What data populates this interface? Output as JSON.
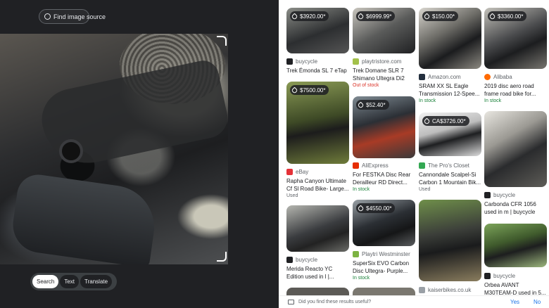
{
  "left": {
    "find_source": "Find image source",
    "modes": [
      "Search",
      "Text",
      "Translate"
    ],
    "active_mode": "Search"
  },
  "results": [
    [
      {
        "price": "$3920.00*",
        "source": "buycycle",
        "title": "Trek Émonda SL 7 eTap",
        "stock": "",
        "favicon_color": "#202124"
      },
      {
        "price": "$7500.00*",
        "source": "eBay",
        "title": "Rapha Canyon Ultimate Cf Sl Road Bike- Large...",
        "stock": "Used",
        "stock_kind": "used",
        "favicon_color": "#e53238"
      },
      {
        "price": "",
        "source": "buycycle",
        "title": "Merida Reacto YC Edition used in l |...",
        "stock": "",
        "favicon_color": "#202124"
      },
      {
        "price": "",
        "source": "",
        "title": "",
        "stock": ""
      }
    ],
    [
      {
        "price": "$6999.99*",
        "source": "playtristore.com",
        "title": "Trek Domane SLR 7 Shimano Ultegra Di2 11...",
        "stock": "Out of stock",
        "stock_kind": "out",
        "favicon_color": "#a3c14a"
      },
      {
        "price": "$52.40*",
        "source": "AliExpress",
        "title": "For FESTKA Disc Rear Derailleur RD Direct...",
        "stock": "In stock",
        "stock_kind": "in",
        "favicon_color": "#e62e04"
      },
      {
        "price": "$4550.00*",
        "source": "Playtri Westminster",
        "title": "SuperSix EVO Carbon Disc Ultegra- Purple...",
        "stock": "In stock",
        "stock_kind": "in",
        "favicon_color": "#7cb342"
      },
      {
        "price": "",
        "source": "",
        "title": "",
        "stock": ""
      }
    ],
    [
      {
        "price": "$150.00*",
        "source": "Amazon.com",
        "title": "SRAM XX SL Eagle Transmission 12-Spee...",
        "stock": "In stock",
        "stock_kind": "in",
        "favicon_color": "#232f3e"
      },
      {
        "price": "CA$3726.00*",
        "source": "The Pro's Closet",
        "title": "Cannondale Scalpel-Si Carbon 1 Mountain Bik...",
        "stock": "Used",
        "stock_kind": "used",
        "favicon_color": "#34a853"
      },
      {
        "price": "",
        "source": "kaiserbikes.co.uk",
        "title": "",
        "stock": "",
        "favicon_color": "#9aa0a6"
      }
    ],
    [
      {
        "price": "$3360.00*",
        "source": "Alibaba",
        "title": "2019 disc aero road frame road bike for...",
        "stock": "In stock",
        "stock_kind": "in",
        "favicon_color": "#ff6a00"
      },
      {
        "price": "",
        "source": "buycycle",
        "title": "Carbonda CFR 1056 used in m | buycycle",
        "stock": "",
        "favicon_color": "#202124"
      },
      {
        "price": "",
        "source": "buycycle",
        "title": "Orbea AVANT M30TEAM-D used in 5...",
        "stock": "",
        "favicon_color": "#202124"
      }
    ]
  ],
  "feedback": {
    "question": "Did you find these results useful?",
    "yes": "Yes",
    "no": "No"
  }
}
